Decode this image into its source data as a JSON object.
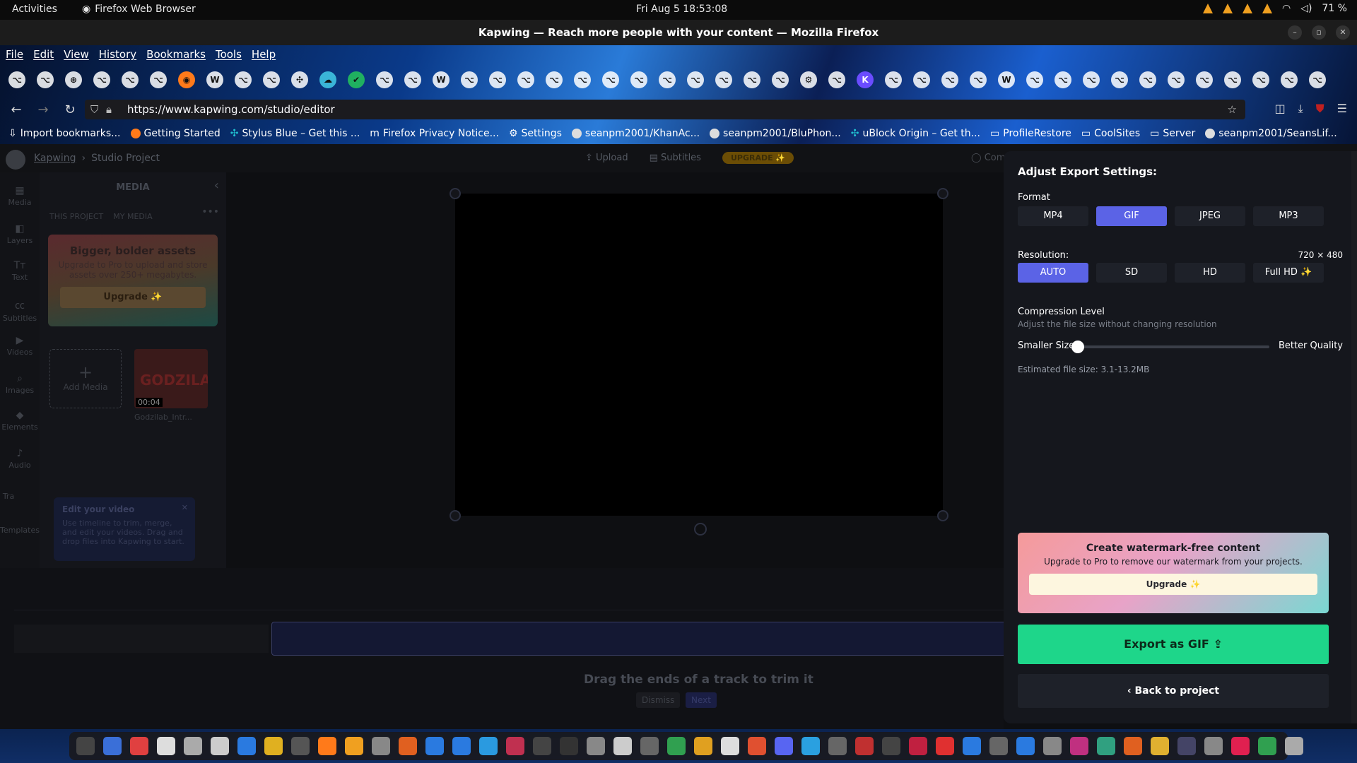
{
  "system": {
    "activities": "Activities",
    "app_name": "Firefox Web Browser",
    "clock": "Fri Aug 5  18:53:08",
    "battery": "71 %"
  },
  "window": {
    "title": "Kapwing — Reach more people with your content — Mozilla Firefox"
  },
  "menu": [
    "File",
    "Edit",
    "View",
    "History",
    "Bookmarks",
    "Tools",
    "Help"
  ],
  "pinned_tabs_count_icon": "github-icon",
  "nav": {
    "url": "https://www.kapwing.com/studio/editor"
  },
  "bookmarks": [
    "Import bookmarks...",
    "Getting Started",
    "Stylus Blue – Get this ...",
    "Firefox Privacy Notice...",
    "Settings",
    "seanpm2001/KhanAc...",
    "seanpm2001/BluPhon...",
    "uBlock Origin – Get th...",
    "ProfileRestore",
    "CoolSites",
    "Server",
    "seanpm2001/SeansLif..."
  ],
  "app": {
    "brand": "Kapwing",
    "crumb_sep": "›",
    "project": "Studio Project",
    "upload": "Upload",
    "subtitles": "Subtitles",
    "upgrade_badge": "UPGRADE ✨",
    "comments": "Comm",
    "rail": [
      "Media",
      "Layers",
      "Text",
      "Subtitles",
      "Videos",
      "Images",
      "Elements",
      "Audio",
      "Tra",
      "Templates"
    ],
    "media_title": "MEDIA",
    "tabs": [
      "THIS PROJECT",
      "MY MEDIA"
    ],
    "upsell": {
      "title": "Bigger, bolder assets",
      "body": "Upgrade to Pro to upload and store assets over 250+ megabytes.",
      "button": "Upgrade ✨"
    },
    "add_media": "Add Media",
    "thumb_duration": "00:04",
    "thumb_text": "GODZILAB",
    "thumb_name": "Godzilab_Intr...",
    "tip": {
      "title": "Edit your video",
      "body": "Use timeline to trim, merge, and edit your videos. Drag and drop files into Kapwing to start."
    },
    "hint": "Drag the ends of a track to trim it",
    "dismiss": "Dismiss",
    "next": "Next"
  },
  "export": {
    "title": "Adjust Export Settings:",
    "format_label": "Format",
    "formats": [
      "MP4",
      "GIF",
      "JPEG",
      "MP3"
    ],
    "resolution_label": "Resolution:",
    "resolution_value": "720 × 480",
    "resolutions": [
      "AUTO",
      "SD",
      "HD",
      "Full HD ✨"
    ],
    "compression_label": "Compression Level",
    "compression_sub": "Adjust the file size without changing resolution",
    "smaller": "Smaller Size",
    "better": "Better Quality",
    "compression_level": 0.0,
    "estimated": "Estimated file size: 3.1-13.2MB",
    "wm_title": "Create watermark-free content",
    "wm_body": "Upgrade to Pro to remove our watermark from your projects.",
    "wm_button": "Upgrade ✨",
    "export_button": "Export as GIF",
    "back_button": "‹  Back to project"
  },
  "accent": "#5b63e6",
  "export_color": "#1ed68a"
}
